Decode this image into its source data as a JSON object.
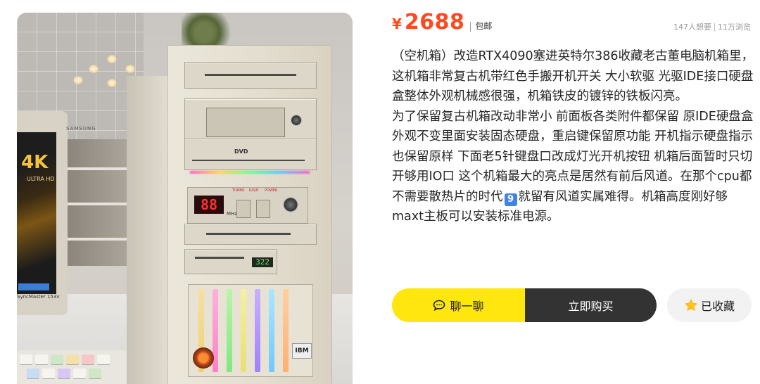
{
  "product": {
    "currency_symbol": "¥",
    "price": "2688",
    "shipping": "包邮",
    "wants": "147人想要",
    "views": "11万浏览",
    "description": [
      "（空机箱）改造RTX4090塞进英特尔386收藏老古董电脑机箱里，这机箱非常复古机带红色手搬开机开关 大小软驱 光驱IDE接口硬盘盒整体外观机械感很强，机箱铁皮的镀锌的铁板闪亮。",
      "为了保留复古机箱改动非常小 前面板各类附件都保留 原IDE硬盘盒外观不变里面安装固态硬盘，重启键保留原功能 开机指示硬盘指示也保留原样 下面老5针键盘口改成灯光开机按钮 机箱后面暂时只切开够用IO口 这个机箱最大的亮点是居然有前后风道。在那个cpu都不需要散热片的时代",
      "就留有风道实属难得。机箱高度刚好够maxt主板可以安装标准电源。"
    ],
    "emoji_digit": "9"
  },
  "photo": {
    "led_display": "88",
    "led_unit": "MHz",
    "led_small": "322",
    "brand_badge": "IBM",
    "monitor_brand": "SAMSUNG",
    "monitor_model": "SyncMaster 153v",
    "screen_title": "4K",
    "screen_sub": "ULTRA HD",
    "dvd_label": "DVD",
    "button_labels": [
      "TURBO",
      "R/S/E",
      "POWER"
    ]
  },
  "actions": {
    "chat_label": "聊一聊",
    "buy_label": "立即购买",
    "fav_label": "已收藏"
  },
  "colors": {
    "price": "#ff4a1f",
    "chat_button": "#ffe60f",
    "buy_button": "#333333",
    "fav_button": "#f2f2f2"
  },
  "icons": {
    "chat": "chat-bubble-icon",
    "favorite": "star-icon"
  }
}
